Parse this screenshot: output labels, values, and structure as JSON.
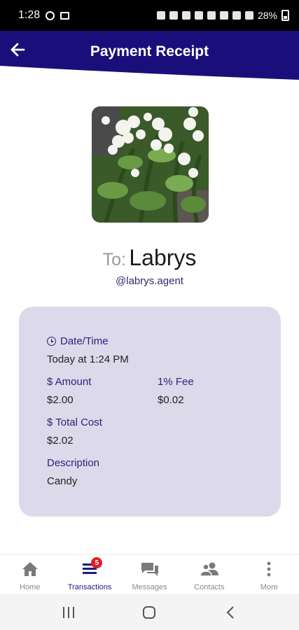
{
  "status_bar": {
    "time": "1:28",
    "battery": "28%"
  },
  "header": {
    "title": "Payment Receipt"
  },
  "recipient": {
    "prefix": "To:",
    "name": "Labrys",
    "handle": "@labrys.agent"
  },
  "receipt": {
    "datetime_label": "Date/Time",
    "datetime_value": "Today at 1:24 PM",
    "amount_label": "$ Amount",
    "amount_value": "$2.00",
    "fee_label": "1% Fee",
    "fee_value": "$0.02",
    "total_label": "$ Total Cost",
    "total_value": "$2.02",
    "description_label": "Description",
    "description_value": "Candy"
  },
  "bottom_nav": {
    "items": [
      {
        "label": "Home",
        "icon": "home-icon"
      },
      {
        "label": "Transactions",
        "icon": "list-icon",
        "badge": "5"
      },
      {
        "label": "Messages",
        "icon": "chat-icon"
      },
      {
        "label": "Contacts",
        "icon": "contacts-icon"
      },
      {
        "label": "More",
        "icon": "more-vertical-icon"
      }
    ]
  },
  "colors": {
    "brand": "#1a0f7a",
    "card_bg": "#dcdaea",
    "label": "#2a2280",
    "badge": "#e02020"
  }
}
